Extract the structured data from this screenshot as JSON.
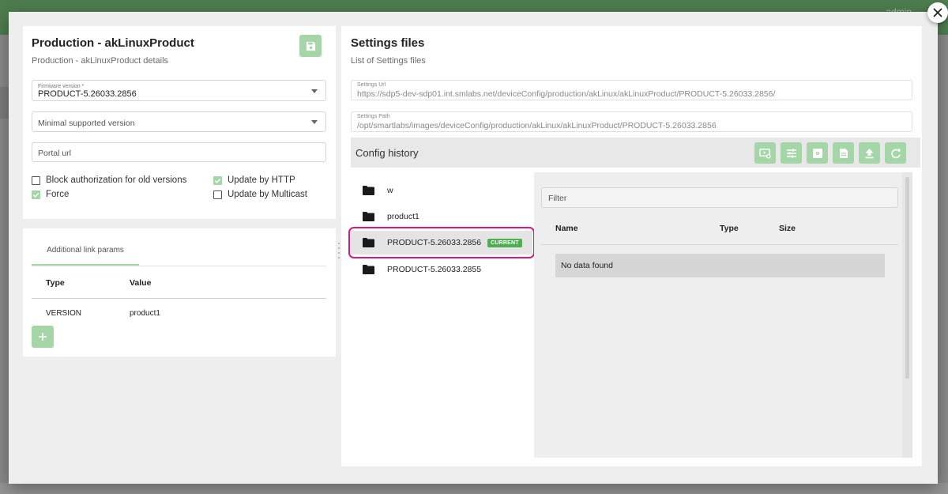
{
  "app": {
    "user": "admin"
  },
  "product": {
    "title": "Production - akLinuxProduct",
    "subtitle": "Production - akLinuxProduct details",
    "firmware": {
      "label": "Firmware version *",
      "value": "PRODUCT-5.26033.2856"
    },
    "min_version": {
      "placeholder": "Minimal supported version"
    },
    "portal_url": {
      "placeholder": "Portal url"
    },
    "checkboxes": {
      "block_auth": {
        "label": "Block authorization for old versions",
        "checked": false
      },
      "update_http": {
        "label": "Update by HTTP",
        "checked": true
      },
      "force": {
        "label": "Force",
        "checked": true
      },
      "update_multicast": {
        "label": "Update by Multicast",
        "checked": false
      }
    }
  },
  "link_params": {
    "tab": "Additional link params",
    "columns": [
      "Type",
      "Value"
    ],
    "rows": [
      {
        "type": "VERSION",
        "value": "product1"
      }
    ]
  },
  "settings": {
    "title": "Settings files",
    "subtitle": "List of Settings files",
    "url": {
      "label": "Settings Url",
      "value": "https://sdp5-dev-sdp01.int.smlabs.net/deviceConfig/production/akLinux/akLinuxProduct/PRODUCT-5.26033.2856/"
    },
    "path": {
      "label": "Settings Path",
      "value": "/opt/smartlabs/images/deviceConfig/production/akLinux/akLinuxProduct/PRODUCT-5.26033.2856"
    }
  },
  "history": {
    "title": "Config history",
    "toolbar_icons": [
      "video-settings-icon",
      "tune-icon",
      "settings-applications-icon",
      "description-icon",
      "upload-icon",
      "refresh-icon"
    ],
    "folders": [
      {
        "name": "w"
      },
      {
        "name": "product1"
      },
      {
        "name": "PRODUCT-5.26033.2856",
        "badge": "CURRENT",
        "selected": true
      },
      {
        "name": "PRODUCT-5.26033.2855"
      }
    ]
  },
  "files": {
    "filter_placeholder": "Filter",
    "columns": [
      "Name",
      "Type",
      "Size"
    ],
    "empty_text": "No data found"
  },
  "colors": {
    "accent": "#a5d6a7",
    "badge": "#4caf50",
    "highlight": "#d81b7a",
    "appbar": "#4d7d4e"
  }
}
